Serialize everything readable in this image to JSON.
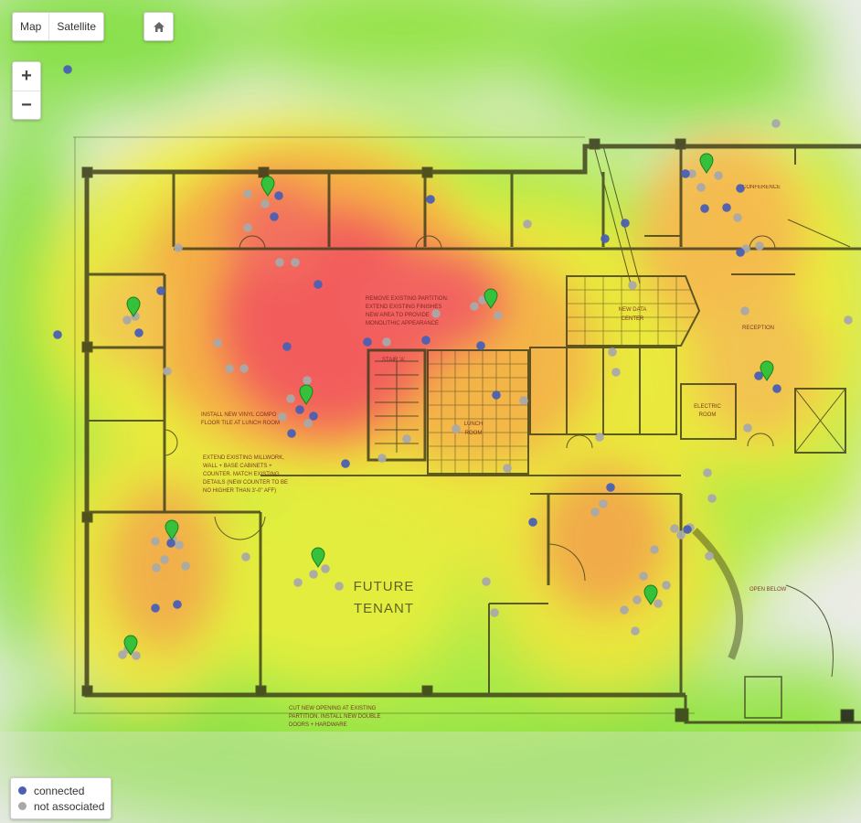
{
  "map_controls": {
    "map_label": "Map",
    "satellite_label": "Satellite",
    "home_icon": "home-icon",
    "zoom_in_label": "+",
    "zoom_out_label": "−"
  },
  "legend": {
    "connected": {
      "label": "connected",
      "color": "#4a5fb3"
    },
    "not_associated": {
      "label": "not associated",
      "color": "#a9a9a9"
    }
  },
  "access_point_icon": "map-marker-icon",
  "access_point_color": "#35c23a",
  "floorplan_labels": {
    "conference": "CONFERENCE",
    "new_data_center": [
      "NEW DATA",
      "CENTER"
    ],
    "reception": "RECEPTION",
    "stair_a": "STAIR 'A'",
    "lunch_room": [
      "LUNCH",
      "ROOM"
    ],
    "electric_room": [
      "ELECTRIC",
      "ROOM"
    ],
    "open_below": "OPEN BELOW",
    "future_tenant": [
      "FUTURE",
      "TENANT"
    ],
    "note_remove_partition": [
      "REMOVE EXISTING PARTITION.",
      "EXTEND EXISTING FINISHES",
      "NEW AREA TO PROVIDE",
      "MONOLITHIC APPEARANCE"
    ],
    "note_vinyl_floor": [
      "INSTALL NEW VINYL COMPO",
      "FLOOR TILE AT LUNCH ROOM"
    ],
    "note_millwork": [
      "EXTEND EXISTING MILLWORK,",
      "WALL + BASE CABINETS +",
      "COUNTER. MATCH EXISTING",
      "DETAILS (NEW COUNTER TO BE",
      "NO HIGHER THAN 3'-0\" AFF)"
    ],
    "note_new_opening": [
      "CUT NEW OPENING AT EXISTING",
      "PARTITION. INSTALL NEW DOUBLE",
      "DOORS + HARDWARE"
    ]
  }
}
